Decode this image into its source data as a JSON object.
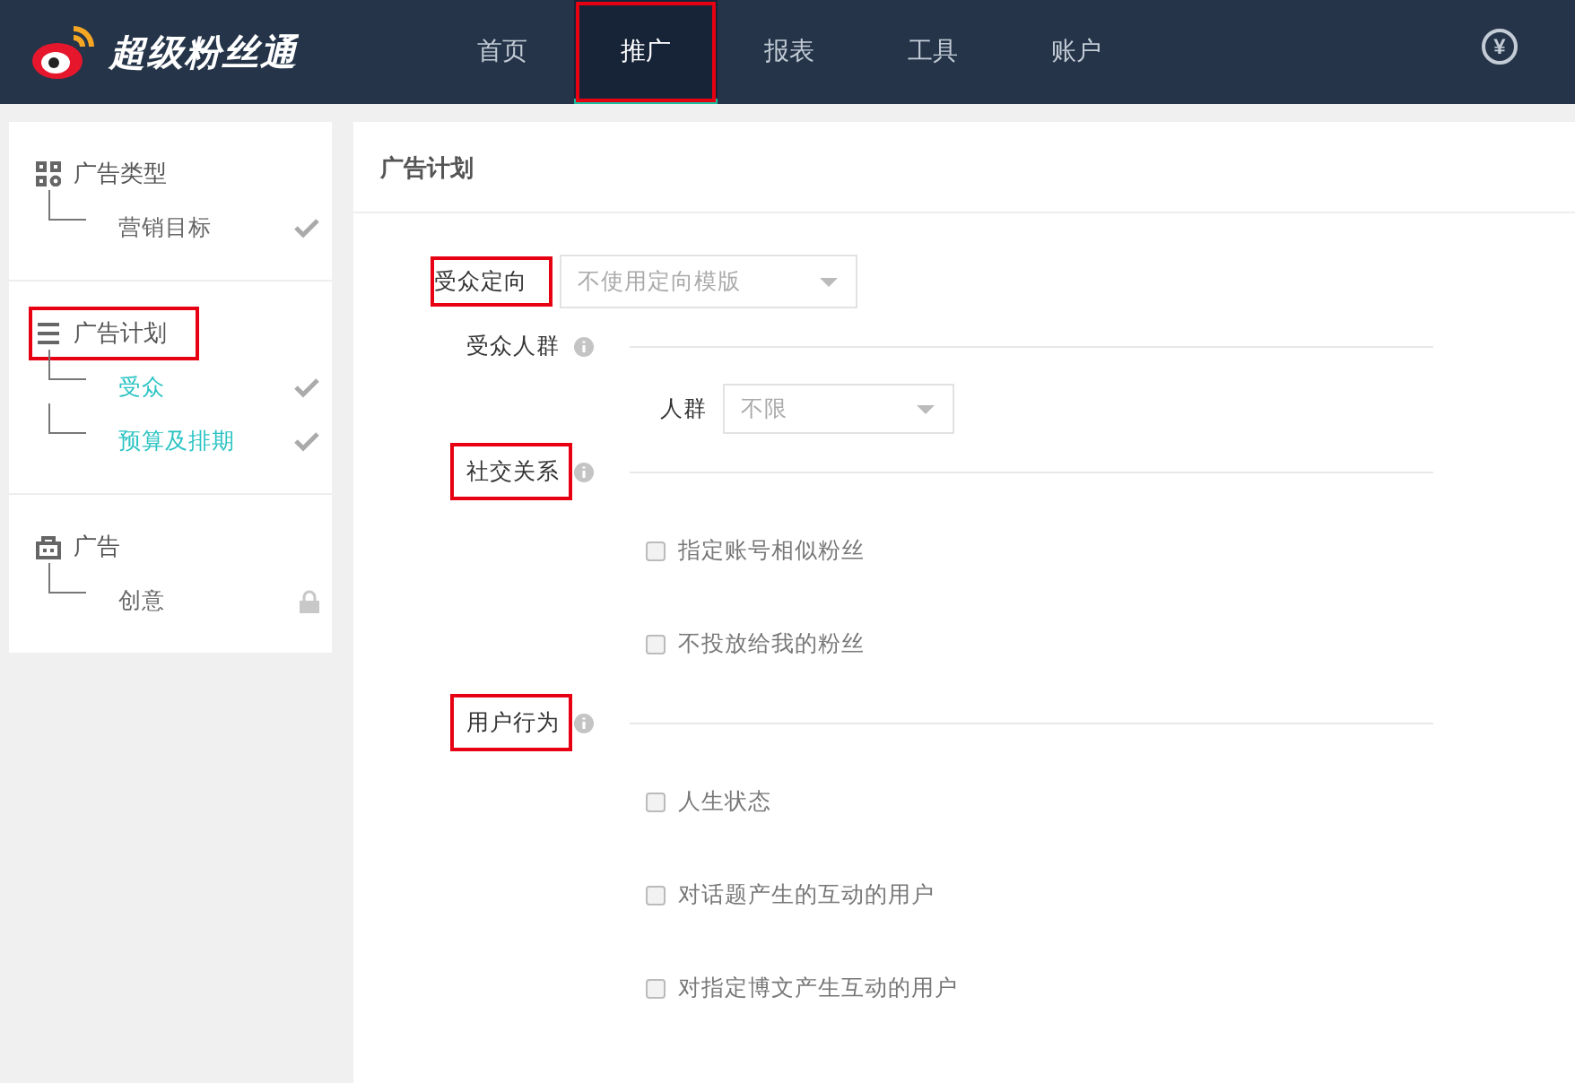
{
  "header": {
    "logo": "超级粉丝通",
    "account_symbol": "¥",
    "nav": [
      {
        "label": "首页",
        "selected": false,
        "highlighted": false
      },
      {
        "label": "推广",
        "selected": true,
        "highlighted": true
      },
      {
        "label": "报表",
        "selected": false,
        "highlighted": false
      },
      {
        "label": "工具",
        "selected": false,
        "highlighted": false
      },
      {
        "label": "账户",
        "selected": false,
        "highlighted": false
      }
    ]
  },
  "sidebar": {
    "sections": [
      {
        "title": "广告类型",
        "highlighted": false,
        "items": [
          {
            "label": "营销目标",
            "active": false,
            "kind": "done"
          }
        ]
      },
      {
        "title": "广告计划",
        "highlighted": true,
        "items": [
          {
            "label": "受众",
            "active": true,
            "kind": "done"
          },
          {
            "label": "预算及排期",
            "active": true,
            "kind": "done"
          }
        ]
      },
      {
        "title": "广告",
        "highlighted": false,
        "items": [
          {
            "label": "创意",
            "active": false,
            "kind": "locked"
          }
        ]
      }
    ]
  },
  "main": {
    "title": "广告计划",
    "rows": [
      {
        "kind": "select",
        "label": "受众定向",
        "value": "不使用定向模版",
        "highlighted": true
      },
      {
        "kind": "section",
        "label": "受众人群",
        "highlighted": false
      },
      {
        "kind": "subselect",
        "label": "人群",
        "value": "不限"
      },
      {
        "kind": "section",
        "label": "社交关系",
        "highlighted": true
      },
      {
        "kind": "checkbox",
        "label": "指定账号相似粉丝",
        "checked": false
      },
      {
        "kind": "checkbox",
        "label": "不投放给我的粉丝",
        "checked": false
      },
      {
        "kind": "section",
        "label": "用户行为",
        "highlighted": true
      },
      {
        "kind": "checkbox",
        "label": "人生状态",
        "checked": false
      },
      {
        "kind": "checkbox",
        "label": "对话题产生的互动的用户",
        "checked": false
      },
      {
        "kind": "checkbox",
        "label": "对指定博文产生互动的用户",
        "checked": false
      }
    ]
  }
}
